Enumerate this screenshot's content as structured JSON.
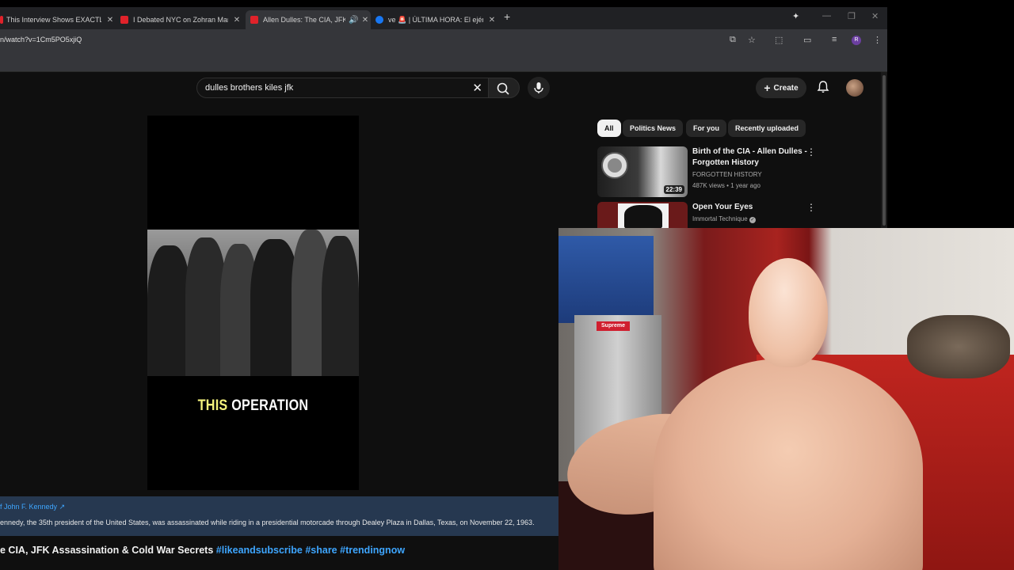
{
  "tabs": [
    {
      "title": "This Interview Shows EXACTLY",
      "favicon_color": "#e0222a"
    },
    {
      "title": "I Debated NYC on Zohran Mam",
      "favicon_color": "#e0222a"
    },
    {
      "title": "Allen Dulles: The CIA, JFK A",
      "favicon_color": "#e0222a"
    },
    {
      "title": "ve 🚨 | ÚLTIMA HORA: El ejército",
      "favicon_color": "#1877f2"
    }
  ],
  "browser": {
    "url": "n/watch?v=1Cm5PO5xjiQ",
    "profile_initial": "R"
  },
  "youtube": {
    "search_query": "dulles brothers kiles jfk",
    "create_label": "Create",
    "chips": [
      "All",
      "Politics News",
      "For you",
      "Recently uploaded"
    ],
    "video_caption_highlight": "THIS",
    "video_caption_rest": "OPERATION",
    "recommendations": [
      {
        "title": "Birth of the CIA - Allen Dulles - Forgotten History",
        "channel": "FORGOTTEN HISTORY",
        "meta": "487K views • 1 year ago",
        "duration": "22:39"
      },
      {
        "title": "Open Your Eyes",
        "channel": "Immortal Technique",
        "meta": "",
        "duration": ""
      }
    ],
    "info_link": "f John F. Kennedy",
    "info_desc": "ennedy, the 35th president of the United States, was assassinated while riding in a presidential motorcade through Dealey Plaza in Dallas, Texas, on November 22, 1963.",
    "video_title_text": "e CIA, JFK Assassination & Cold War Secrets",
    "video_title_tags": "#likeandsubscribe #share #trendingnow"
  },
  "webcam": {
    "sticker_text": "Supreme"
  },
  "colors": {
    "yt_bg": "#0f0f0f",
    "link_blue": "#3ea6ff",
    "caption_yellow": "#f4f27c"
  }
}
